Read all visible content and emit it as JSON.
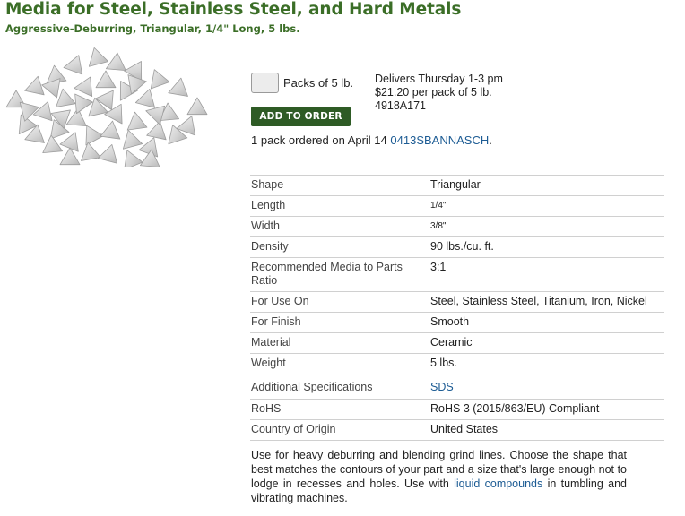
{
  "product": {
    "title": "Media for Steel, Stainless Steel, and Hard Metals",
    "subtitle": "Aggressive-Deburring, Triangular, 1/4\" Long, 5 lbs."
  },
  "purchase": {
    "quantity_value": "",
    "unit_label": "Packs of 5 lb.",
    "delivery": "Delivers Thursday 1-3 pm",
    "price": "$21.20 per pack of 5 lb.",
    "part_number": "4918A171",
    "add_button_label": "ADD TO ORDER",
    "order_note_prefix": "1 pack ordered on April 14",
    "order_ref": "0413SBANNASCH",
    "order_note_suffix": "."
  },
  "specs": [
    {
      "label": "Shape",
      "value": "Triangular"
    },
    {
      "label": "Length",
      "value": "1/4\""
    },
    {
      "label": "Width",
      "value": "3/8\""
    },
    {
      "label": "Density",
      "value": "90 lbs./cu. ft."
    },
    {
      "label": "Recommended Media to Parts Ratio",
      "value": "3:1"
    },
    {
      "label": "For Use On",
      "value": "Steel, Stainless Steel, Titanium, Iron, Nickel"
    },
    {
      "label": "For Finish",
      "value": "Smooth"
    },
    {
      "label": "Material",
      "value": "Ceramic"
    },
    {
      "label": "Weight",
      "value": "5 lbs."
    },
    {
      "label": "Additional Specifications",
      "value": "SDS"
    },
    {
      "label": "RoHS",
      "value": "RoHS 3 (2015/863/EU) Compliant"
    },
    {
      "label": "Country of Origin",
      "value": "United States"
    }
  ],
  "description": {
    "text_before_link": "Use for heavy deburring and blending grind lines. Choose the shape that best matches the contours of your part and a size that's large enough not to lodge in recesses and holes. Use with",
    "link_text": "liquid compounds",
    "text_after_link": "in tumbling and vibrating machines."
  },
  "colors": {
    "title_green": "#3b6e27",
    "button_green": "#2e5b25",
    "link_blue": "#1d5c94",
    "divider_gray": "#d0d0d0"
  },
  "icons": {
    "product_image": "ceramic-triangle-media-photo"
  }
}
